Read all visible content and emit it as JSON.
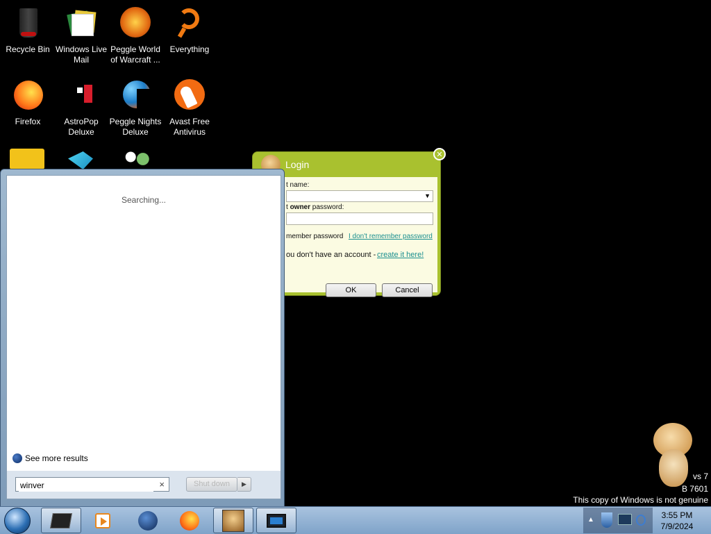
{
  "desktop": {
    "icons": [
      {
        "label": "Recycle Bin",
        "icon": "recycle-bin-icon"
      },
      {
        "label": "Windows Live Mail",
        "icon": "windows-live-mail-icon"
      },
      {
        "label": "Peggle World of Warcraft ...",
        "icon": "peggle-wow-icon"
      },
      {
        "label": "Everything",
        "icon": "everything-search-icon"
      },
      {
        "label": "Firefox",
        "icon": "firefox-icon"
      },
      {
        "label": "AstroPop Deluxe",
        "icon": "astropop-icon"
      },
      {
        "label": "Peggle Nights Deluxe",
        "icon": "peggle-nights-icon"
      },
      {
        "label": "Avast Free Antivirus",
        "icon": "avast-icon"
      }
    ]
  },
  "start_menu": {
    "status": "Searching...",
    "see_more": "See more results",
    "search_value": "winver",
    "shutdown_label": "Shut down"
  },
  "login_dialog": {
    "title": "Login",
    "account_label": "t name:",
    "password_label_prefix": "t",
    "password_label_bold": "owner",
    "password_label_suffix": "password:",
    "remember_label": "member password",
    "forgot_link": "I don't remember password",
    "no_account_text": "ou don't have an account -",
    "create_link": "create it here!",
    "ok_label": "OK",
    "cancel_label": "Cancel"
  },
  "watermark": {
    "line1": "vs 7",
    "line2": "7601",
    "line2_prefix": "B",
    "line3": "This copy of Windows is not genuine"
  },
  "taskbar": {
    "time": "3:55 PM",
    "date": "7/9/2024",
    "pinned": [
      "explorer-window-icon",
      "media-player-icon",
      "globe-app-icon",
      "firefox-icon",
      "hamsterbox-icon",
      "monitor-app-icon"
    ]
  },
  "colors": {
    "dialog_green": "#a9c12f",
    "link_teal": "#1a8f8f",
    "taskbar": "#8fb0d3"
  }
}
